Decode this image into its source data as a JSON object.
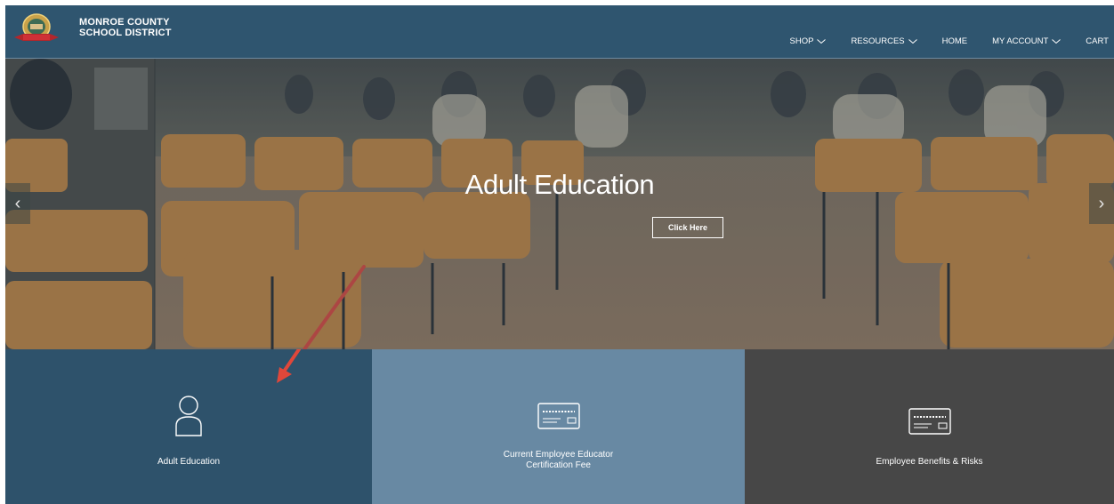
{
  "header": {
    "brand_line1": "MONROE COUNTY",
    "brand_line2": "SCHOOL DISTRICT",
    "logo_icon": "district-seal-icon"
  },
  "nav": {
    "items": [
      {
        "label": "SHOP",
        "has_dropdown": true
      },
      {
        "label": "RESOURCES",
        "has_dropdown": true
      },
      {
        "label": "HOME",
        "has_dropdown": false
      },
      {
        "label": "MY ACCOUNT",
        "has_dropdown": true
      },
      {
        "label": "CART",
        "has_dropdown": false
      }
    ]
  },
  "hero": {
    "title": "Adult Education",
    "button_label": "Click Here",
    "prev_arrow": "‹",
    "next_arrow": "›"
  },
  "cards": [
    {
      "label": "Adult Education",
      "icon": "user-icon",
      "color": "#2e526b"
    },
    {
      "label_line1": "Current Employee Educator",
      "label_line2": "Certification Fee",
      "icon": "credit-card-icon",
      "color": "#6889a3"
    },
    {
      "label": "Employee Benefits & Risks",
      "icon": "credit-card-icon",
      "color": "#474747"
    }
  ],
  "annotation": {
    "arrow_color": "#e0473a"
  },
  "colors": {
    "header_bg": "#2f556f",
    "white": "#ffffff"
  }
}
